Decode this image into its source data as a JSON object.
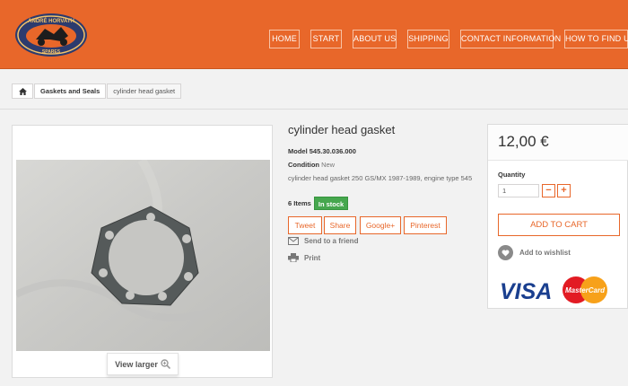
{
  "header": {
    "logo": {
      "top_text": "ANDRÉ HORVATH",
      "bottom_text": "SPARES"
    },
    "nav": [
      "HOME",
      "START",
      "ABOUT US",
      "SHIPPING",
      "CONTACT INFORMATION",
      "HOW TO FIND US"
    ]
  },
  "breadcrumb": {
    "home_icon": "home-icon",
    "items": [
      "Gaskets and Seals",
      "cylinder head gasket"
    ]
  },
  "product": {
    "title": "cylinder head gasket",
    "model_label": "Model",
    "model_value": "545.30.036.000",
    "condition_label": "Condition",
    "condition_value": "New",
    "description": "cylinder head gasket 250 GS/MX 1987-1989, engine type 545",
    "items_count": "6 Items",
    "stock_label": "In stock",
    "view_larger": "View larger",
    "share_buttons": [
      "Tweet",
      "Share",
      "Google+",
      "Pinterest"
    ],
    "send_to_friend": "Send to a friend",
    "print": "Print"
  },
  "buy": {
    "price": "12,00 €",
    "quantity_label": "Quantity",
    "quantity_value": "1",
    "minus": "−",
    "plus": "+",
    "add_to_cart": "ADD TO CART",
    "wishlist": "Add to wishlist",
    "payment": {
      "visa": "VISA",
      "mastercard": "MasterCard"
    }
  },
  "colors": {
    "accent": "#e8672a",
    "stock_green": "#46a74e",
    "background": "#f2f2f2"
  }
}
